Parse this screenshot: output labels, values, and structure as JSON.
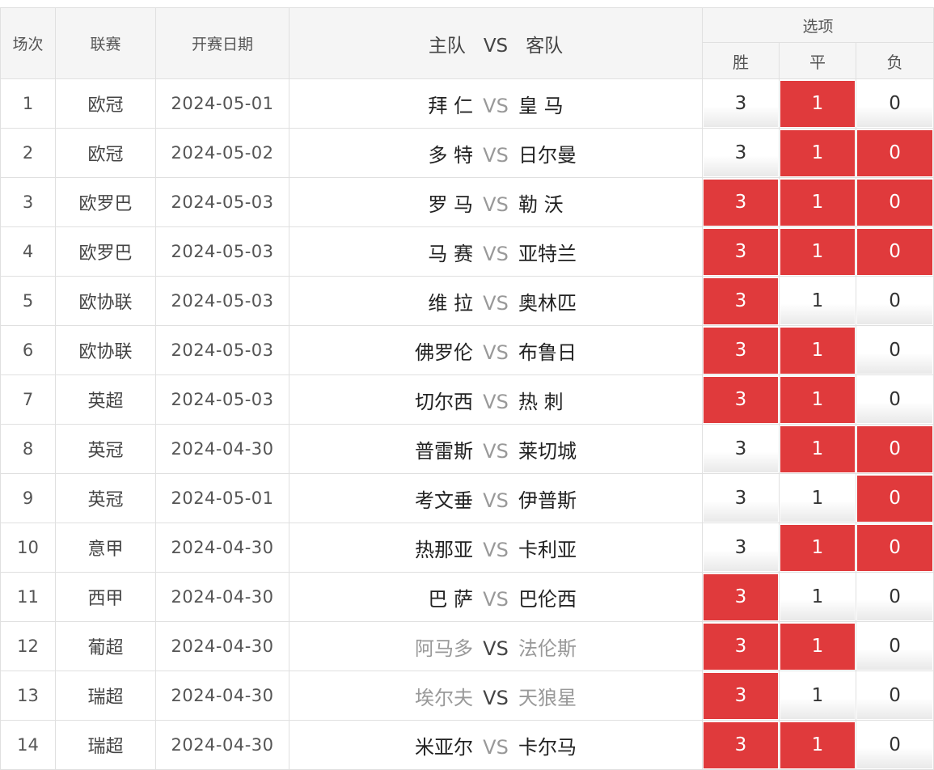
{
  "header": {
    "idx": "场次",
    "league": "联赛",
    "date": "开赛日期",
    "home": "主队",
    "vs": "VS",
    "away": "客队",
    "options": "选项",
    "win": "胜",
    "draw": "平",
    "loss": "负"
  },
  "colors": {
    "selected": "#e03a3c",
    "muted_team": "#999999"
  },
  "rows": [
    {
      "idx": "1",
      "league": "欧冠",
      "date": "2024-05-01",
      "home": "拜 仁",
      "vs": "VS",
      "away": "皇 马",
      "win": "3",
      "draw": "1",
      "loss": "0",
      "sel": [
        false,
        true,
        false
      ],
      "muted": false
    },
    {
      "idx": "2",
      "league": "欧冠",
      "date": "2024-05-02",
      "home": "多 特",
      "vs": "VS",
      "away": "日尔曼",
      "win": "3",
      "draw": "1",
      "loss": "0",
      "sel": [
        false,
        true,
        true
      ],
      "muted": false
    },
    {
      "idx": "3",
      "league": "欧罗巴",
      "date": "2024-05-03",
      "home": "罗 马",
      "vs": "VS",
      "away": "勒 沃",
      "win": "3",
      "draw": "1",
      "loss": "0",
      "sel": [
        true,
        true,
        true
      ],
      "muted": false
    },
    {
      "idx": "4",
      "league": "欧罗巴",
      "date": "2024-05-03",
      "home": "马 赛",
      "vs": "VS",
      "away": "亚特兰",
      "win": "3",
      "draw": "1",
      "loss": "0",
      "sel": [
        true,
        true,
        true
      ],
      "muted": false
    },
    {
      "idx": "5",
      "league": "欧协联",
      "date": "2024-05-03",
      "home": "维 拉",
      "vs": "VS",
      "away": "奥林匹",
      "win": "3",
      "draw": "1",
      "loss": "0",
      "sel": [
        true,
        false,
        false
      ],
      "muted": false
    },
    {
      "idx": "6",
      "league": "欧协联",
      "date": "2024-05-03",
      "home": "佛罗伦",
      "vs": "VS",
      "away": "布鲁日",
      "win": "3",
      "draw": "1",
      "loss": "0",
      "sel": [
        true,
        true,
        false
      ],
      "muted": false
    },
    {
      "idx": "7",
      "league": "英超",
      "date": "2024-05-03",
      "home": "切尔西",
      "vs": "VS",
      "away": "热 刺",
      "win": "3",
      "draw": "1",
      "loss": "0",
      "sel": [
        true,
        true,
        false
      ],
      "muted": false
    },
    {
      "idx": "8",
      "league": "英冠",
      "date": "2024-04-30",
      "home": "普雷斯",
      "vs": "VS",
      "away": "莱切城",
      "win": "3",
      "draw": "1",
      "loss": "0",
      "sel": [
        false,
        true,
        true
      ],
      "muted": false
    },
    {
      "idx": "9",
      "league": "英冠",
      "date": "2024-05-01",
      "home": "考文垂",
      "vs": "VS",
      "away": "伊普斯",
      "win": "3",
      "draw": "1",
      "loss": "0",
      "sel": [
        false,
        false,
        true
      ],
      "muted": false
    },
    {
      "idx": "10",
      "league": "意甲",
      "date": "2024-04-30",
      "home": "热那亚",
      "vs": "VS",
      "away": "卡利亚",
      "win": "3",
      "draw": "1",
      "loss": "0",
      "sel": [
        false,
        true,
        true
      ],
      "muted": false
    },
    {
      "idx": "11",
      "league": "西甲",
      "date": "2024-04-30",
      "home": "巴 萨",
      "vs": "VS",
      "away": "巴伦西",
      "win": "3",
      "draw": "1",
      "loss": "0",
      "sel": [
        true,
        false,
        false
      ],
      "muted": false
    },
    {
      "idx": "12",
      "league": "葡超",
      "date": "2024-04-30",
      "home": "阿马多",
      "vs": "VS",
      "away": "法伦斯",
      "win": "3",
      "draw": "1",
      "loss": "0",
      "sel": [
        true,
        true,
        false
      ],
      "muted": true
    },
    {
      "idx": "13",
      "league": "瑞超",
      "date": "2024-04-30",
      "home": "埃尔夫",
      "vs": "VS",
      "away": "天狼星",
      "win": "3",
      "draw": "1",
      "loss": "0",
      "sel": [
        true,
        false,
        false
      ],
      "muted": true
    },
    {
      "idx": "14",
      "league": "瑞超",
      "date": "2024-04-30",
      "home": "米亚尔",
      "vs": "VS",
      "away": "卡尔马",
      "win": "3",
      "draw": "1",
      "loss": "0",
      "sel": [
        true,
        true,
        false
      ],
      "muted": false
    }
  ]
}
